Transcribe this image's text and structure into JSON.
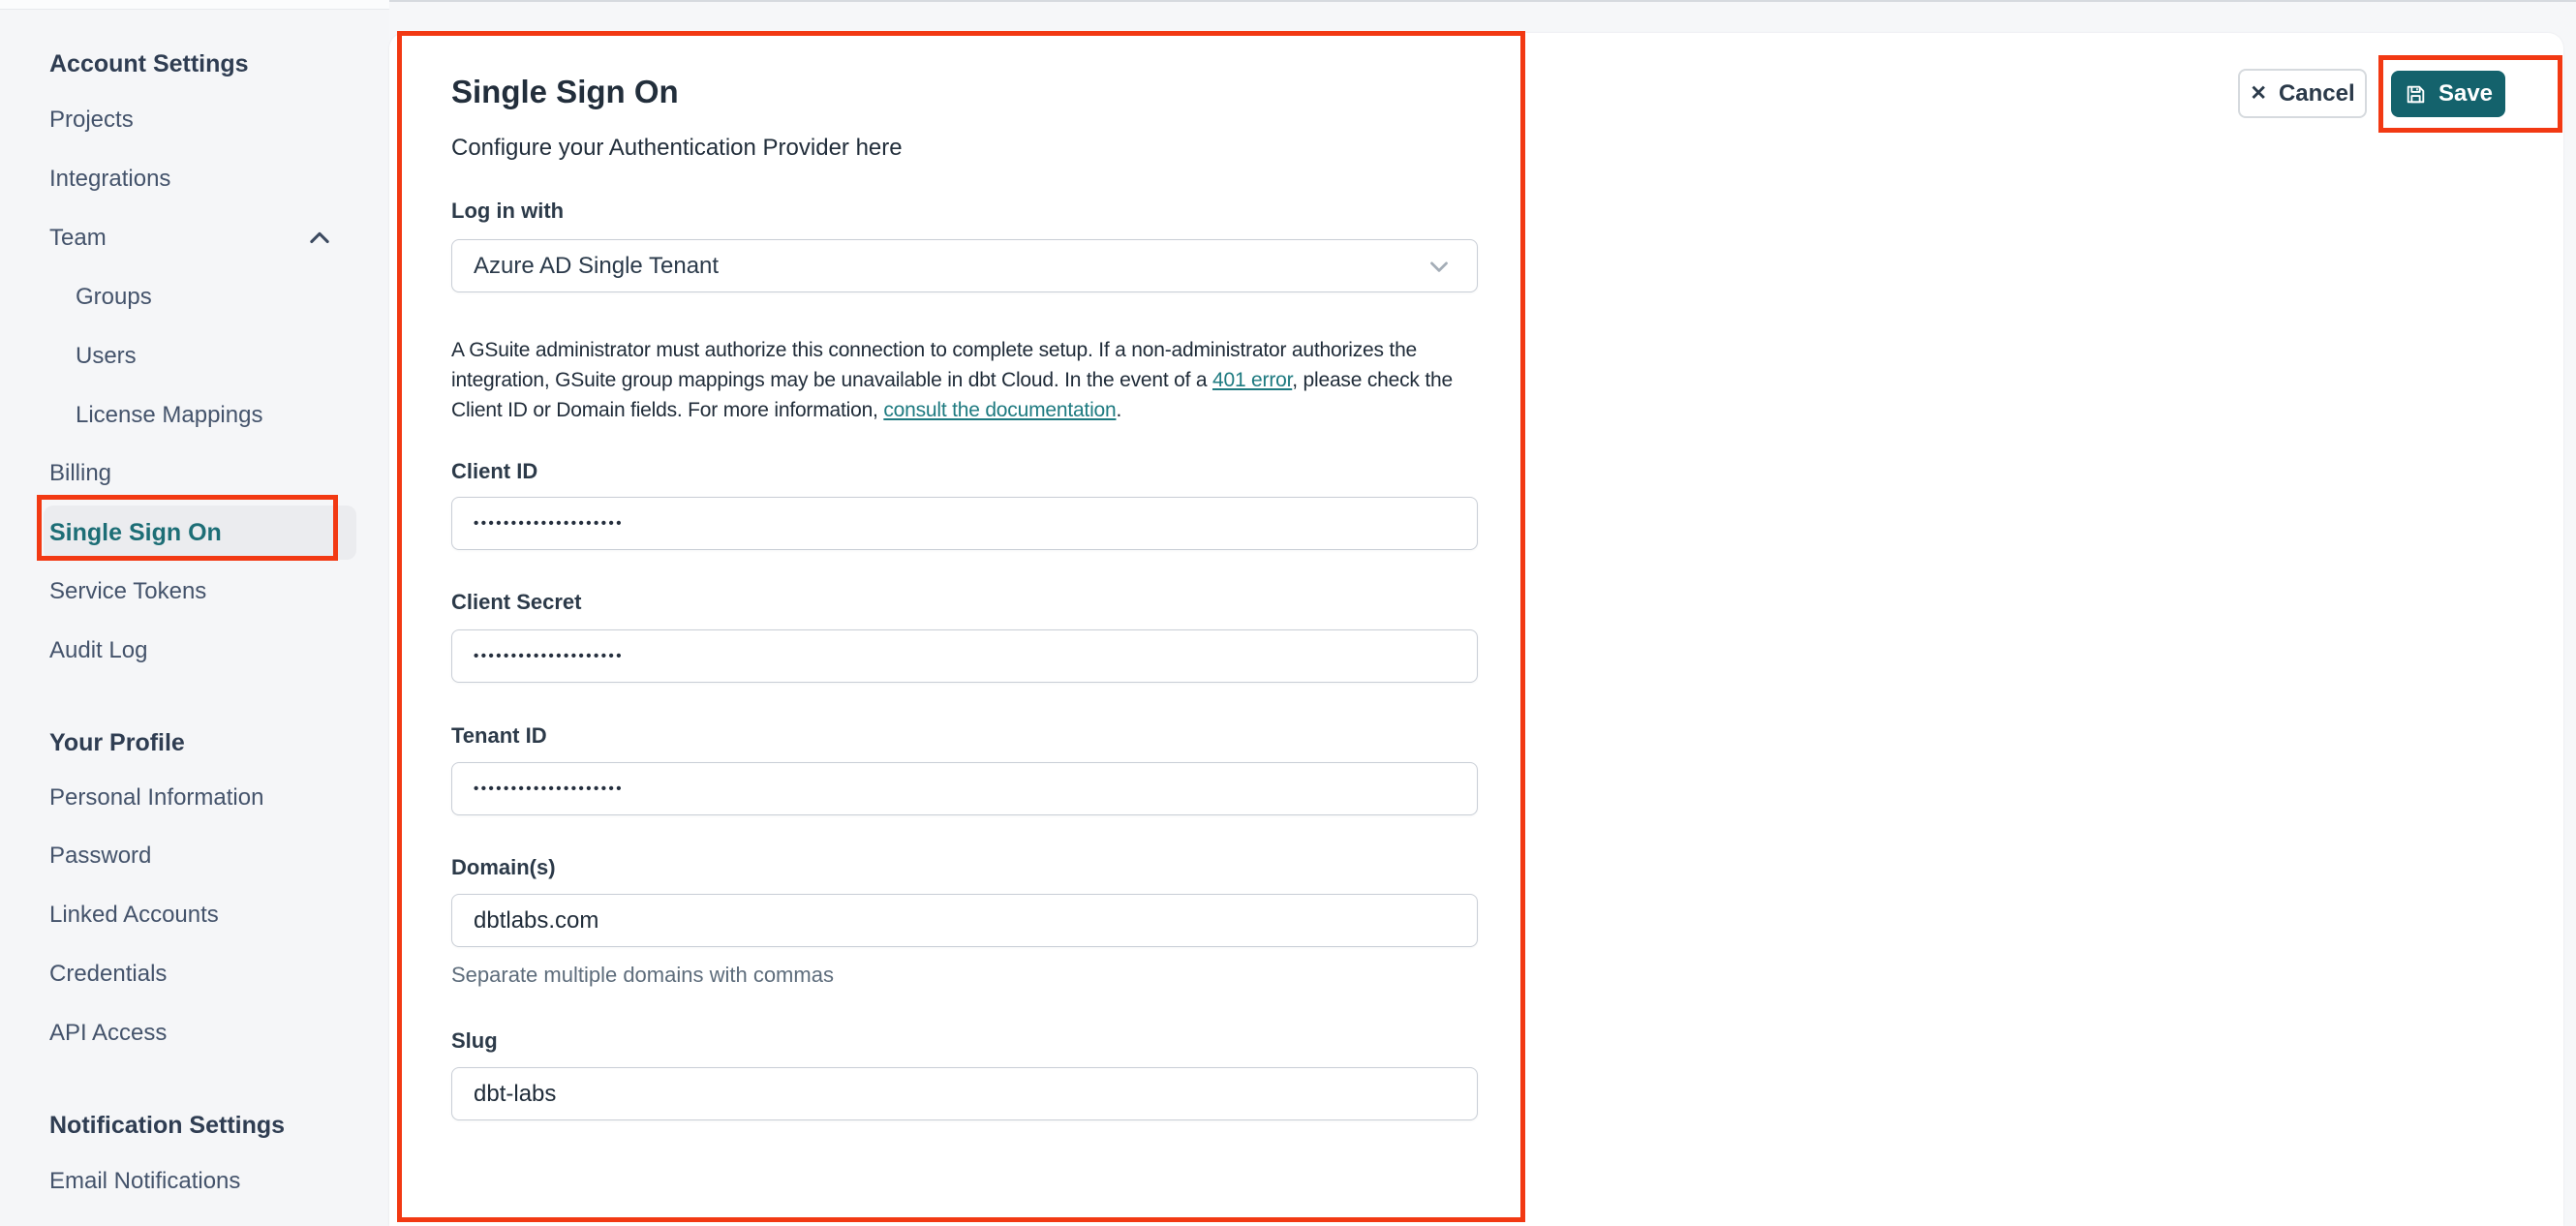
{
  "colors": {
    "annotation_red": "#f23913",
    "save_button_teal": "#14626c",
    "active_item_teal": "#1d6e76",
    "link_teal": "#1e7a80",
    "sidebar_bg": "#f5f6f8",
    "card_bg": "#ffffff"
  },
  "sidebar": {
    "items": [
      {
        "label": "Account Settings"
      },
      {
        "label": "Projects"
      },
      {
        "label": "Integrations"
      },
      {
        "label": "Team"
      },
      {
        "label": "Groups"
      },
      {
        "label": "Users"
      },
      {
        "label": "License Mappings"
      },
      {
        "label": "Billing"
      },
      {
        "label": "Single Sign On"
      },
      {
        "label": "Service Tokens"
      },
      {
        "label": "Audit Log"
      },
      {
        "label": "Your Profile"
      },
      {
        "label": "Personal Information"
      },
      {
        "label": "Password"
      },
      {
        "label": "Linked Accounts"
      },
      {
        "label": "Credentials"
      },
      {
        "label": "API Access"
      },
      {
        "label": "Notification Settings"
      },
      {
        "label": "Email Notifications"
      }
    ],
    "active_item": "Single Sign On"
  },
  "main": {
    "title": "Single Sign On",
    "subtitle": "Configure your Authentication Provider here",
    "actions": {
      "cancel_label": "Cancel",
      "save_label": "Save"
    },
    "form": {
      "login_with": {
        "label": "Log in with",
        "value": "Azure AD Single Tenant"
      },
      "notice": {
        "part1": "A GSuite administrator must authorize this connection to complete setup. If a non-administrator authorizes the integration, GSuite group mappings may be unavailable in dbt Cloud. In the event of a ",
        "link1": "401 error",
        "part2": ", please check the Client ID or Domain fields. For more information, ",
        "link2": "consult the documentation",
        "part3": "."
      },
      "client_id": {
        "label": "Client ID",
        "masked_value": "••••••••••••••••••••"
      },
      "client_secret": {
        "label": "Client Secret",
        "masked_value": "••••••••••••••••••••"
      },
      "tenant_id": {
        "label": "Tenant ID",
        "masked_value": "••••••••••••••••••••"
      },
      "domains": {
        "label": "Domain(s)",
        "value": "dbtlabs.com",
        "helper": "Separate multiple domains with commas"
      },
      "slug": {
        "label": "Slug",
        "value": "dbt-labs"
      }
    }
  }
}
